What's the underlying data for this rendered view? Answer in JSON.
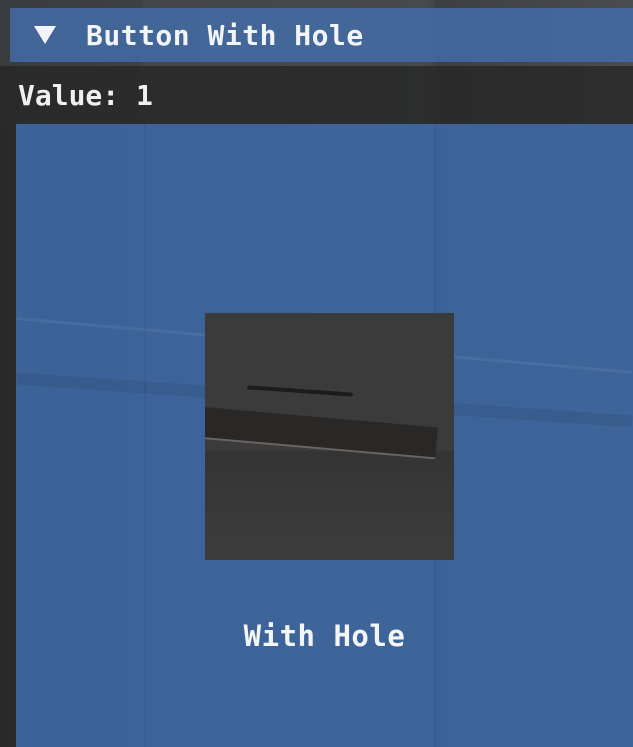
{
  "window": {
    "title": "Button With Hole",
    "collapse_icon": "triangle-down-icon"
  },
  "value_row": {
    "text": "Value: 1"
  },
  "hole_button": {
    "label": "With Hole"
  },
  "colors": {
    "title_bar": "#426eaa",
    "button_fill": "#3c69a5",
    "hole": "#3b3b3b",
    "text": "#f2f4f7"
  }
}
